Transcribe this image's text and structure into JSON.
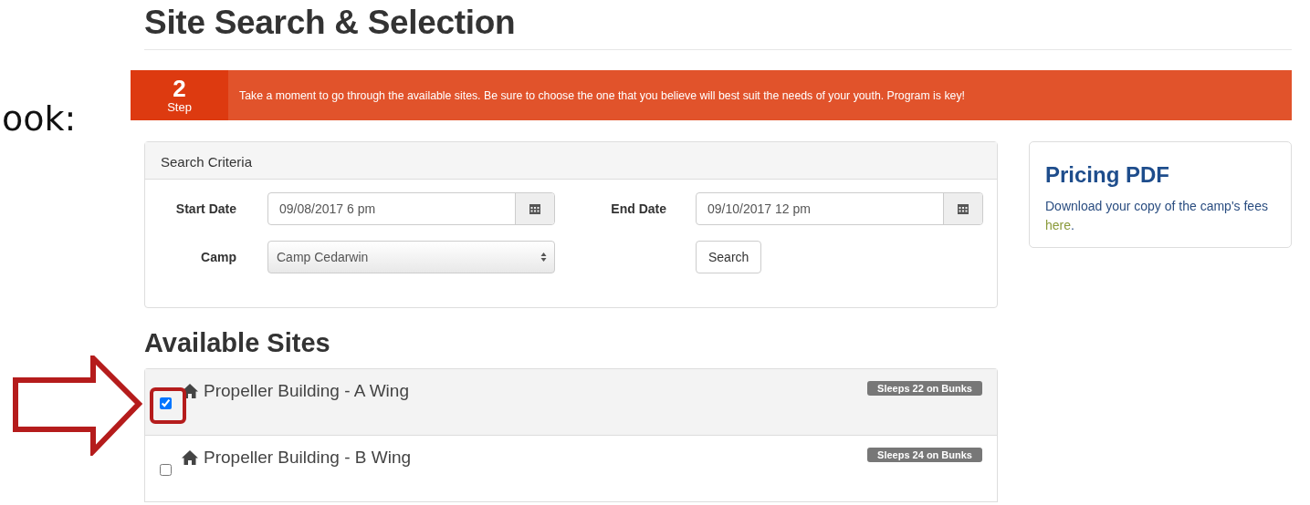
{
  "slide_text": "ook:",
  "page_title": "Site Search & Selection",
  "step": {
    "number": "2",
    "label": "Step",
    "message": "Take a moment to go through the available sites. Be sure to choose the one that you believe will best suit the needs of your youth. Program is key!"
  },
  "search_panel": {
    "title": "Search Criteria",
    "start_date": {
      "label": "Start Date",
      "value": "09/08/2017 6 pm"
    },
    "end_date": {
      "label": "End Date",
      "value": "09/10/2017 12 pm"
    },
    "camp": {
      "label": "Camp",
      "value": "Camp Cedarwin"
    },
    "search_button": "Search"
  },
  "pricing": {
    "title": "Pricing PDF",
    "text": "Download your copy of the camp's fees ",
    "link": "here",
    "after": "."
  },
  "sites_title": "Available Sites",
  "sites": [
    {
      "name": "Propeller Building - A Wing",
      "badge": "Sleeps 22 on Bunks",
      "checked": true
    },
    {
      "name": "Propeller Building - B Wing",
      "badge": "Sleeps 24 on Bunks",
      "checked": false
    }
  ]
}
